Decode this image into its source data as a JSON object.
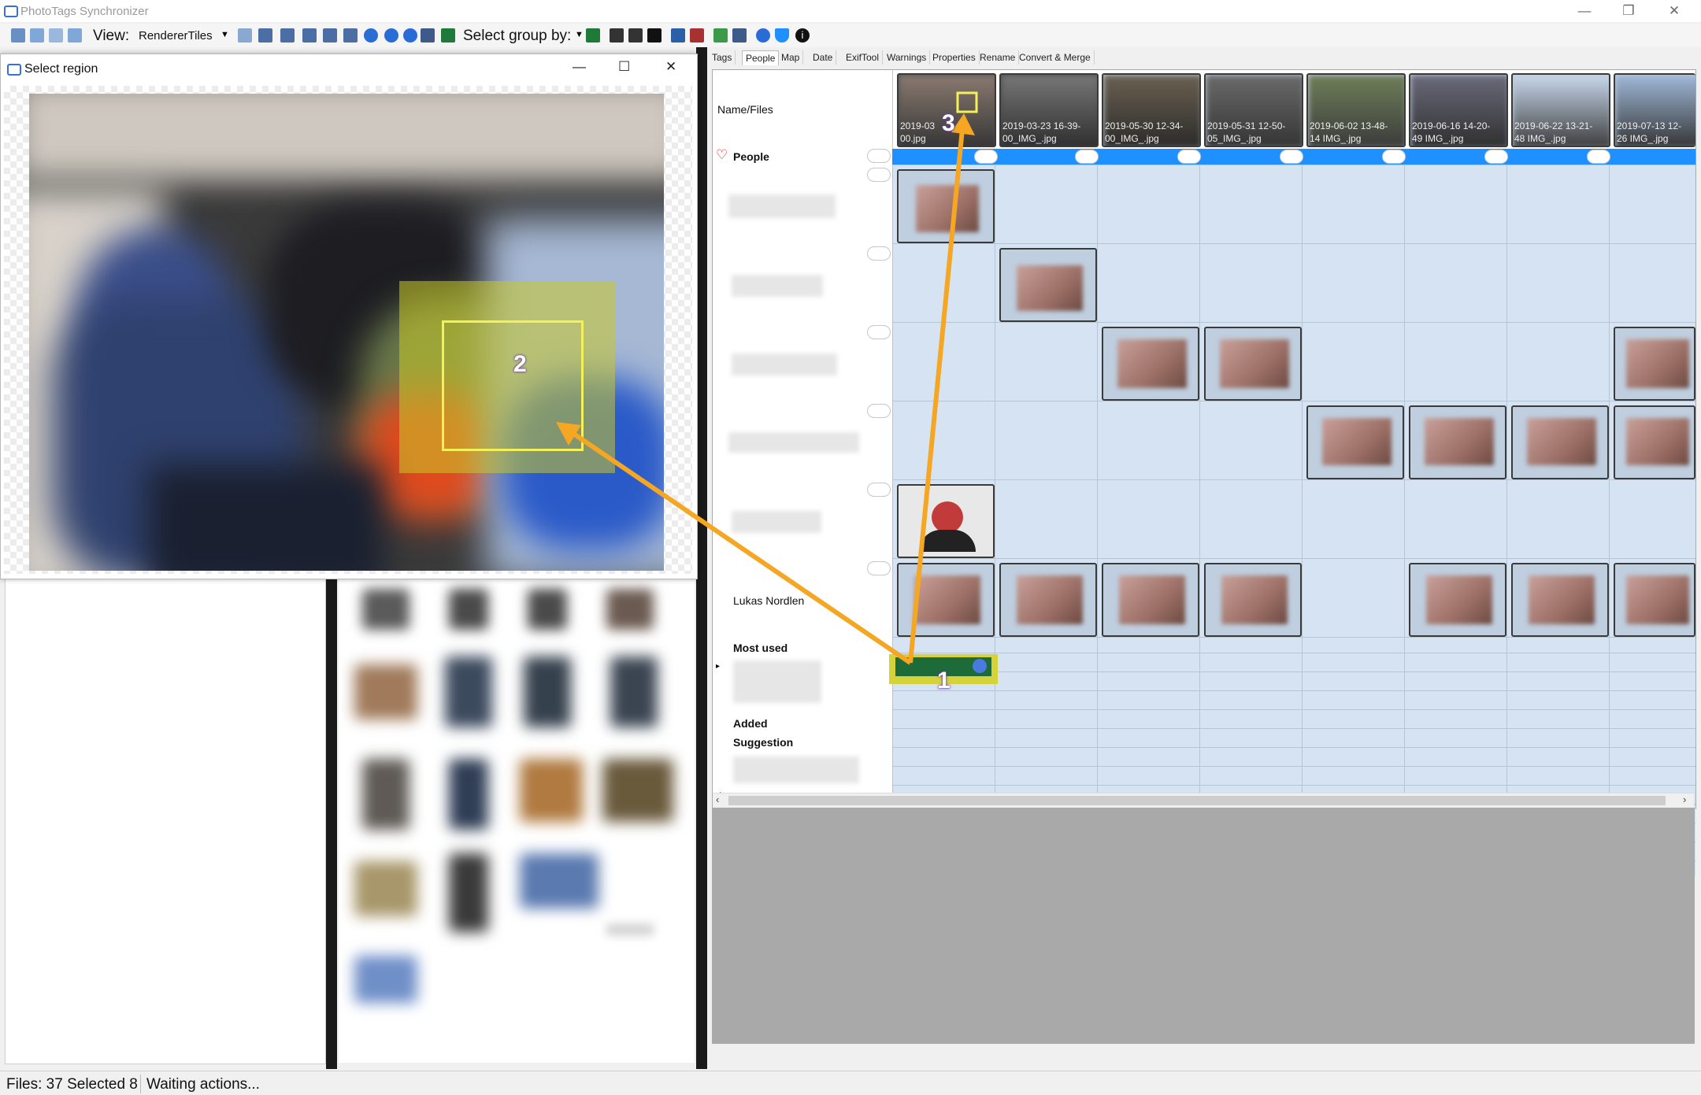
{
  "app": {
    "title": "PhotoTags Synchronizer"
  },
  "window_controls": {
    "minimize": "—",
    "maximize": "❐",
    "close": "✕"
  },
  "toolbar": {
    "view_label": "View:",
    "view_value": "RendererTiles",
    "group_label": "Select group by:"
  },
  "dialog": {
    "title": "Select region",
    "controls": {
      "minimize": "—",
      "maximize": "☐",
      "close": "✕"
    }
  },
  "tabs": [
    "Tags",
    "People",
    "Map",
    "Date",
    "ExifTool",
    "Warnings",
    "Properties",
    "Rename",
    "Convert & Merge"
  ],
  "active_tab": "People",
  "grid": {
    "header_label": "Name/Files",
    "files": [
      {
        "line1": "2019-03",
        "line2": "00.jpg"
      },
      {
        "line1": "2019-03-23 16-39-",
        "line2": "00_IMG_.jpg"
      },
      {
        "line1": "2019-05-30 12-34-",
        "line2": "00_IMG_.jpg"
      },
      {
        "line1": "2019-05-31 12-50-",
        "line2": "05_IMG_.jpg"
      },
      {
        "line1": "2019-06-02 13-48-",
        "line2": "14 IMG_.jpg"
      },
      {
        "line1": "2019-06-16 14-20-",
        "line2": "49 IMG_.jpg"
      },
      {
        "line1": "2019-06-22 13-21-",
        "line2": "48 IMG_.jpg"
      },
      {
        "line1": "2019-07-13 12-",
        "line2": "26 IMG_.jpg"
      }
    ],
    "people_label": "People",
    "named_person": "Lukas Nordlen",
    "most_used_label": "Most used",
    "added_label": "Added",
    "suggestion_label": "Suggestion"
  },
  "annotations": {
    "m1": "1",
    "m2": "2",
    "m3": "3"
  },
  "status": {
    "files": "Files: 37 Selected 8",
    "action": "Waiting actions..."
  },
  "colors": {
    "accent_blue": "#1e90ff",
    "annotation": "#f5a623",
    "selection_green": "#1e6b3a",
    "cell_bg": "#d6e3f2"
  }
}
